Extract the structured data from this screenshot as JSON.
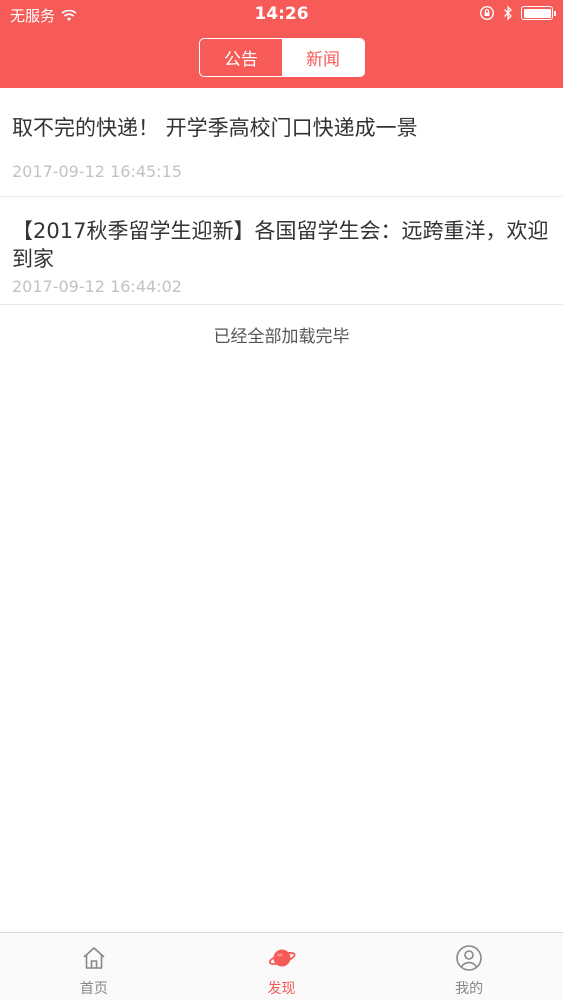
{
  "status_bar": {
    "carrier": "无服务",
    "time": "14:26",
    "battery_level": 1.0
  },
  "segment": {
    "tabs": [
      {
        "label": "公告",
        "active": false
      },
      {
        "label": "新闻",
        "active": true
      }
    ]
  },
  "news": [
    {
      "title": "取不完的快递！ 开学季高校门口快递成一景",
      "time": "2017-09-12 16:45:15"
    },
    {
      "title": "【2017秋季留学生迎新】各国留学生会：远跨重洋，欢迎到家",
      "time": "2017-09-12 16:44:02"
    }
  ],
  "load_status": "已经全部加载完毕",
  "tabbar": {
    "items": [
      {
        "label": "首页",
        "icon": "home-icon"
      },
      {
        "label": "发现",
        "icon": "planet-icon",
        "active": true
      },
      {
        "label": "我的",
        "icon": "profile-icon"
      }
    ]
  },
  "colors": {
    "accent": "#f65b58",
    "title_text": "#333333",
    "time_text": "#c2c2c2",
    "inactive_tab": "#888888"
  }
}
